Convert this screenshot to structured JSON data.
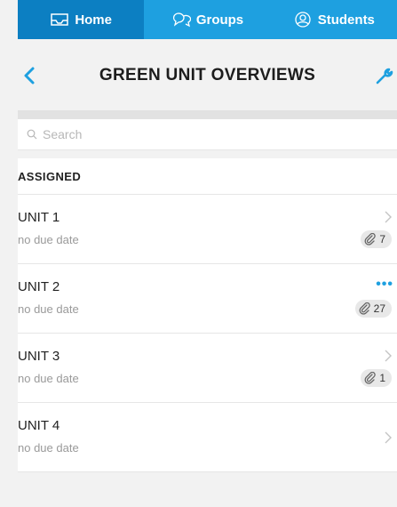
{
  "tabs": [
    {
      "label": "Home",
      "icon": "inbox-icon",
      "active": true
    },
    {
      "label": "Groups",
      "icon": "chat-bubbles-icon",
      "active": false
    },
    {
      "label": "Students",
      "icon": "student-icon",
      "active": false
    }
  ],
  "header": {
    "title": "GREEN UNIT OVERVIEWS"
  },
  "search": {
    "placeholder": "Search",
    "value": ""
  },
  "section": {
    "label": "ASSIGNED"
  },
  "units": [
    {
      "name": "UNIT 1",
      "due": "no due date",
      "attachments": "7",
      "action": "chevron"
    },
    {
      "name": "UNIT 2",
      "due": "no due date",
      "attachments": "27",
      "action": "more"
    },
    {
      "name": "UNIT 3",
      "due": "no due date",
      "attachments": "1",
      "action": "chevron"
    },
    {
      "name": "UNIT 4",
      "due": "no due date",
      "action": "chevron"
    }
  ],
  "colors": {
    "accent": "#1ea0e0",
    "accent_dark": "#0c7fc2"
  }
}
